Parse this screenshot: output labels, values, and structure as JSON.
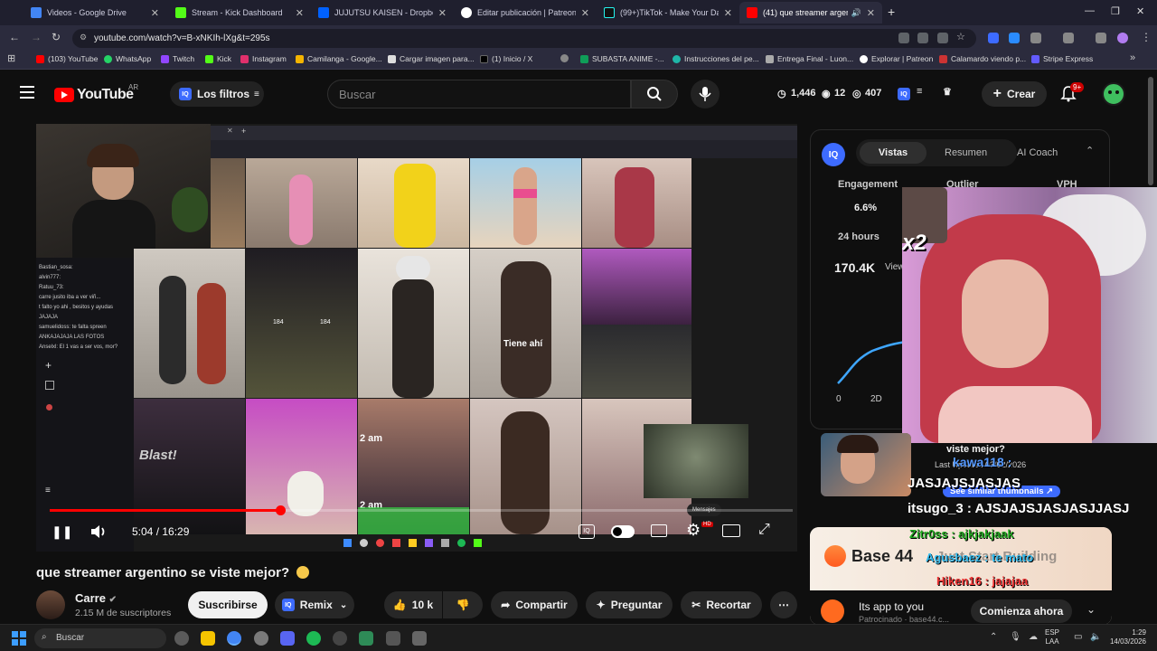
{
  "browser": {
    "tabs": [
      {
        "title": "Videos - Google Drive",
        "color": "#4285f4"
      },
      {
        "title": "Stream - Kick Dashboard",
        "color": "#53fc18"
      },
      {
        "title": "JUJUTSU KAISEN - Dropbox",
        "color": "#0061ff"
      },
      {
        "title": "Editar publicación | Patreon",
        "color": "#ffffff"
      },
      {
        "title": "(99+)TikTok - Make Your Day",
        "color": "#111111"
      },
      {
        "title": "(41) que streamer argentino",
        "color": "#ff0000"
      }
    ],
    "new_tab": "+",
    "url": "youtube.com/watch?v=B-xNKIh-lXg&t=295s",
    "bookmarks": [
      {
        "label": "(103) YouTube",
        "color": "#ff0000"
      },
      {
        "label": "WhatsApp",
        "color": "#25d366"
      },
      {
        "label": "Twitch",
        "color": "#9146ff"
      },
      {
        "label": "Kick",
        "color": "#53fc18"
      },
      {
        "label": "Instagram",
        "color": "#e1306c"
      },
      {
        "label": "Camilanga - Google...",
        "color": "#f4b400"
      },
      {
        "label": "Cargar imagen para...",
        "color": "#dddddd"
      },
      {
        "label": "(1) Inicio / X",
        "color": "#000000"
      },
      {
        "label": "",
        "color": "#888888"
      },
      {
        "label": "SUBASTA ANIME -...",
        "color": "#0f9d58"
      },
      {
        "label": "Instrucciones del pe...",
        "color": "#1fb6a8"
      },
      {
        "label": "Entrega Final - Luon...",
        "color": "#aaaaaa"
      },
      {
        "label": "Explorar | Patreon",
        "color": "#ffffff"
      },
      {
        "label": "Calamardo viendo p...",
        "color": "#cc3333"
      },
      {
        "label": "Stripe Express",
        "color": "#635bff"
      }
    ]
  },
  "youtube": {
    "logo": "YouTube",
    "region": "AR",
    "filters_label": "Los filtros",
    "iq_badge": "IQ",
    "search_placeholder": "Buscar",
    "stats": {
      "views": "1,446",
      "clicks": "12",
      "score": "407"
    },
    "create_label": "Crear",
    "notif_count": "9+"
  },
  "video": {
    "time": "5:04 / 16:29",
    "progress": 0.31,
    "inner_tab": "+",
    "inner_overlays": [
      "Tiene ahí",
      "2 am",
      "2 am",
      "Blast!",
      "184",
      "184",
      "x2",
      "Mensajes"
    ],
    "chat_lines": [
      "Bastian_sosa:",
      "alvin777:",
      "Ratuu_73:",
      "carre jusito iba a ver viñ...",
      "t falto yo ahi , besitos y ayudas JAJAJA",
      "samuelidoss: te falta spreen",
      "ANKAJAJAJA LAS FOTOS",
      "Anselxl: El 1 vas a ser vos, mor?"
    ]
  },
  "iq_panel": {
    "tabs": [
      "Vistas",
      "Resumen",
      "AI Coach"
    ],
    "metrics": [
      "Engagement",
      "Outlier",
      "VPH"
    ],
    "engagement": "6.6%",
    "period": "24 hours",
    "views_big": "170.4K",
    "views_suffix": "View",
    "axis": [
      "0",
      "2D"
    ]
  },
  "thumb_overlay": {
    "updated": "Last Updated 03/02/2026",
    "see_similar": "See similar thumbnails"
  },
  "chat_overlay": [
    {
      "text": "viste mejor?",
      "color": "#ffffff"
    },
    {
      "text": "kawa118 :",
      "color": "#ff3333"
    },
    {
      "text": "JASJAJSJASJAS",
      "color": "#ffffff"
    },
    {
      "text": "itsugo_3 : AJSJAJSJASJASJJASJ",
      "color": "#ffffff"
    },
    {
      "text": "Zitr0ss : ajkjakjaak",
      "color": "#55ff55"
    },
    {
      "text": "Agusbaez : te mato",
      "color": "#55ddff"
    },
    {
      "text": "Hiken16 : jajajaa",
      "color": "#ff5555"
    }
  ],
  "ad": {
    "brand": "Base 44",
    "headline": "Just Start Building",
    "text": "Its app to you",
    "sponsor": "Patrocinado · base44.c...",
    "cta": "Comienza ahora"
  },
  "meta": {
    "title": "que streamer argentino se viste mejor?",
    "channel": "Carre",
    "subs": "2.15 M de suscriptores",
    "subscribe": "Suscribirse",
    "remix": "Remix",
    "likes": "10 k",
    "share": "Compartir",
    "ask": "Preguntar",
    "clip": "Recortar",
    "more": "⋯"
  },
  "taskbar": {
    "search": "Buscar",
    "lang": "ESP",
    "lang2": "LAA",
    "time": "1:29",
    "date": "14/03/2026"
  }
}
